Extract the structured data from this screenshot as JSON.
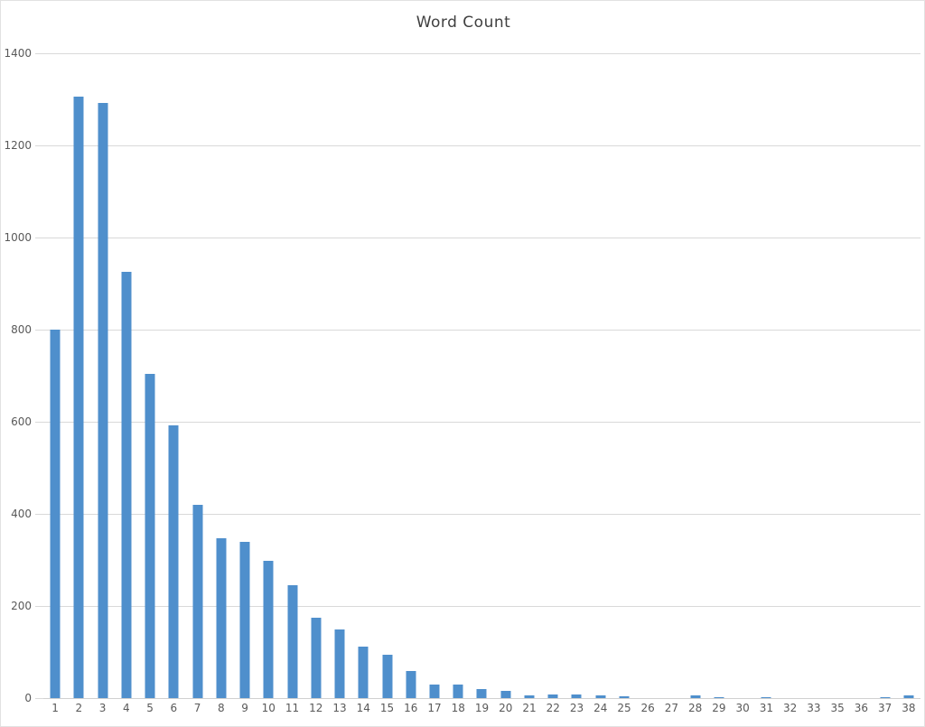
{
  "chart_data": {
    "type": "bar",
    "title": "Word Count",
    "xlabel": "",
    "ylabel": "",
    "ylim": [
      0,
      1400
    ],
    "ytick_step": 200,
    "yticks": [
      0,
      200,
      400,
      600,
      800,
      1000,
      1200,
      1400
    ],
    "ytick_labels": [
      "0",
      "200",
      "400",
      "600",
      "800",
      "1000",
      "1200",
      "1400"
    ],
    "grid": true,
    "legend": false,
    "legend_position": "none",
    "bar_color": "#4f8fcc",
    "gridline_color": "#d9d9d9",
    "axis_text_color": "#595959",
    "title_color": "#404040",
    "background_color": "#ffffff",
    "categories": [
      "1",
      "2",
      "3",
      "4",
      "5",
      "6",
      "7",
      "8",
      "9",
      "10",
      "11",
      "12",
      "13",
      "14",
      "15",
      "16",
      "17",
      "18",
      "19",
      "20",
      "21",
      "22",
      "23",
      "24",
      "25",
      "26",
      "27",
      "28",
      "29",
      "30",
      "31",
      "32",
      "33",
      "35",
      "36",
      "37",
      "38"
    ],
    "values": [
      800,
      1305,
      1292,
      925,
      703,
      592,
      420,
      348,
      339,
      298,
      246,
      175,
      150,
      112,
      94,
      58,
      30,
      29,
      19,
      16,
      5,
      8,
      7,
      5,
      3,
      0,
      0,
      5,
      2,
      0,
      2,
      0,
      0,
      0,
      0,
      1,
      5
    ],
    "series": [
      {
        "name": "Word Count",
        "values": [
          800,
          1305,
          1292,
          925,
          703,
          592,
          420,
          348,
          339,
          298,
          246,
          175,
          150,
          112,
          94,
          58,
          30,
          29,
          19,
          16,
          5,
          8,
          7,
          5,
          3,
          0,
          0,
          5,
          2,
          0,
          2,
          0,
          0,
          0,
          0,
          1,
          5
        ]
      }
    ]
  }
}
